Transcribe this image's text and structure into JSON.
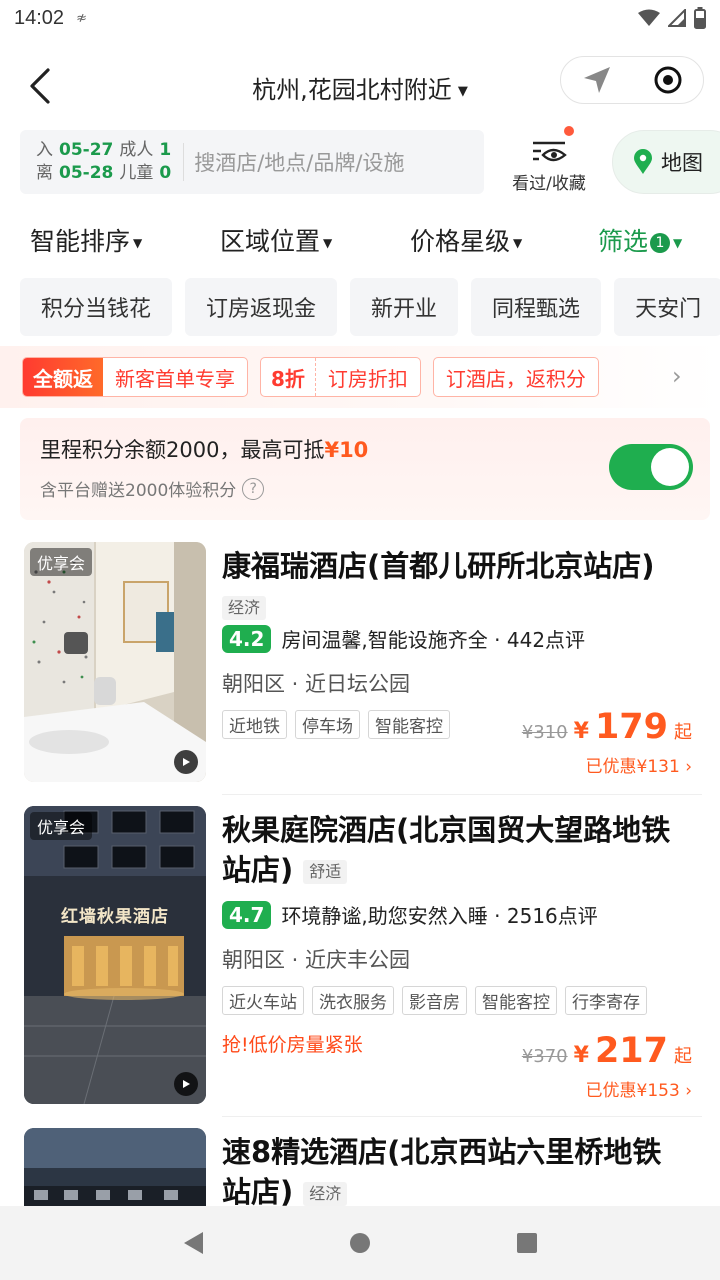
{
  "status_bar": {
    "time": "14:02",
    "extra": "≉"
  },
  "header": {
    "title": "杭州,花园北村附近"
  },
  "search": {
    "checkin_label": "入",
    "checkin_date": "05-27",
    "checkout_label": "离",
    "checkout_date": "05-28",
    "adults_label": "成人",
    "adults": "1",
    "children_label": "儿童",
    "children": "0",
    "placeholder": "搜酒店/地点/品牌/设施",
    "history_label": "看过/收藏",
    "map_label": "地图"
  },
  "sort_bar": {
    "smart_sort": "智能排序",
    "area": "区域位置",
    "price_star": "价格星级",
    "filter": "筛选",
    "filter_count": "1"
  },
  "quick_tags": [
    "积分当钱花",
    "订房返现金",
    "新开业",
    "同程甄选",
    "天安门"
  ],
  "promos": {
    "p1_tag": "全额返",
    "p1_text": "新客首单专享",
    "p2_tag": "8折",
    "p2_text": "订房折扣",
    "p3_text": "订酒店，返积分"
  },
  "points": {
    "text": "里程积分余额2000，最高可抵",
    "amount": "¥10",
    "sub": "含平台赠送2000体验积分",
    "toggle_on": true
  },
  "hotels": [
    {
      "badge": "优享会",
      "name": "康福瑞酒店(首都儿研所北京站店)",
      "level": "经济",
      "score": "4.2",
      "review": "房间温馨,智能设施齐全 · 442点评",
      "location": "朝阳区 · 近日坛公园",
      "facilities": [
        "近地铁",
        "停车场",
        "智能客控"
      ],
      "original_price": "¥310",
      "currency": "¥",
      "price": "179",
      "qi": "起",
      "saved": "已优惠¥131"
    },
    {
      "badge": "优享会",
      "name_line1": "秋果庭院酒店(北京国贸大望路地铁",
      "name_line2": "站店)",
      "level": "舒适",
      "sign_text": "红墙秋果酒店",
      "score": "4.7",
      "review": "环境静谧,助您安然入睡 · 2516点评",
      "location": "朝阳区 · 近庆丰公园",
      "facilities": [
        "近火车站",
        "洗衣服务",
        "影音房",
        "智能客控",
        "行李寄存"
      ],
      "urgent": "抢!低价房量紧张",
      "original_price": "¥370",
      "currency": "¥",
      "price": "217",
      "qi": "起",
      "saved": "已优惠¥153"
    },
    {
      "name_line1": "速8精选酒店(北京西站六里桥地铁",
      "name_line2": "站店)",
      "level": "经济"
    }
  ]
}
